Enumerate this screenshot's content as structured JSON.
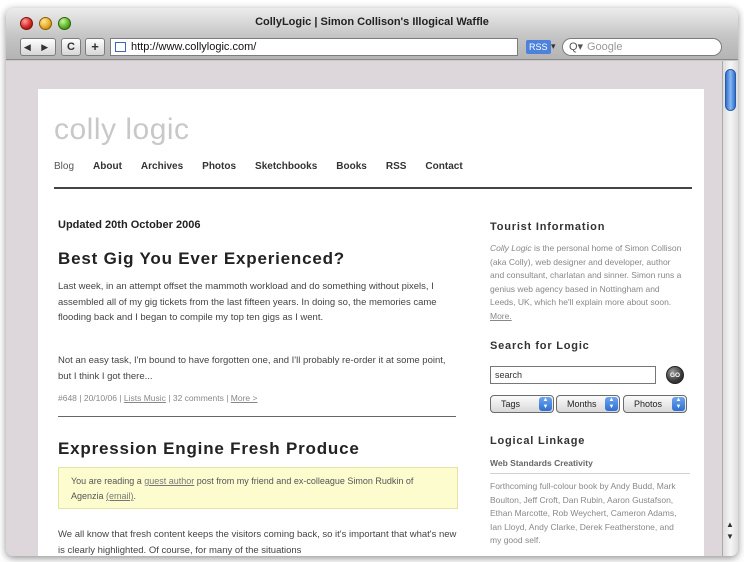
{
  "window": {
    "title": "CollyLogic | Simon Collison's Illogical Waffle"
  },
  "toolbar": {
    "back_forward_label": "◀ ▶",
    "reload_label": "C",
    "add_label": "+",
    "url": "http://www.collylogic.com/",
    "rss_label": "RSS",
    "search_placeholder": "Google"
  },
  "site": {
    "logo": "colly logic",
    "nav": [
      "Blog",
      "About",
      "Archives",
      "Photos",
      "Sketchbooks",
      "Books",
      "RSS",
      "Contact"
    ]
  },
  "main": {
    "updated": "Updated 20th October 2006",
    "posts": [
      {
        "title": "Best Gig You Ever Experienced?",
        "paragraphs": [
          "Last week, in an attempt offset the mammoth workload and do something without pixels, I assembled all of my gig tickets from the last fifteen years. In doing so, the memories came flooding back and I began to compile my top ten gigs as I went.",
          "Not an easy task, I'm bound to have forgotten one, and I'll probably re-order it at some point, but I think I got there..."
        ],
        "meta_prefix": "#648 | 20/10/06 | ",
        "meta_tags": "Lists Music",
        "meta_comments": " | 32 comments | ",
        "meta_more": "More >"
      },
      {
        "title": "Expression Engine Fresh Produce",
        "callout_prefix": "You are reading a ",
        "callout_link1": "guest author",
        "callout_mid": " post from my friend and ex-colleague Simon Rudkin of Agenzia ",
        "callout_link2": "(email)",
        "callout_suffix": ".",
        "paragraph": "We all know that fresh content keeps the visitors coming back, so it's important that what's new is clearly highlighted. Of course, for many of the situations"
      }
    ]
  },
  "sidebar": {
    "tourist_heading": "Tourist Information",
    "tourist_em": "Colly Logic",
    "tourist_text": " is the personal home of Simon Collison (aka Colly), web designer and developer, author and consultant, charlatan and sinner. Simon runs a genius web agency based in Nottingham and Leeds, UK, which he'll explain more about soon. ",
    "tourist_more": "More.",
    "search_heading": "Search for Logic",
    "search_value": "search",
    "go_label": "GO",
    "selects": [
      "Tags",
      "Months",
      "Photos"
    ],
    "linkage_heading": "Logical Linkage",
    "linkage_sub": "Web Standards Creativity",
    "linkage_text": "Forthcoming full-colour book by Andy Budd, Mark Boulton, Jeff Croft, Dan Rubin, Aaron Gustafson, Ethan Marcotte, Rob Weychert, Cameron Adams, Ian Lloyd, Andy Clarke, Derek Featherstone, and my good self."
  }
}
